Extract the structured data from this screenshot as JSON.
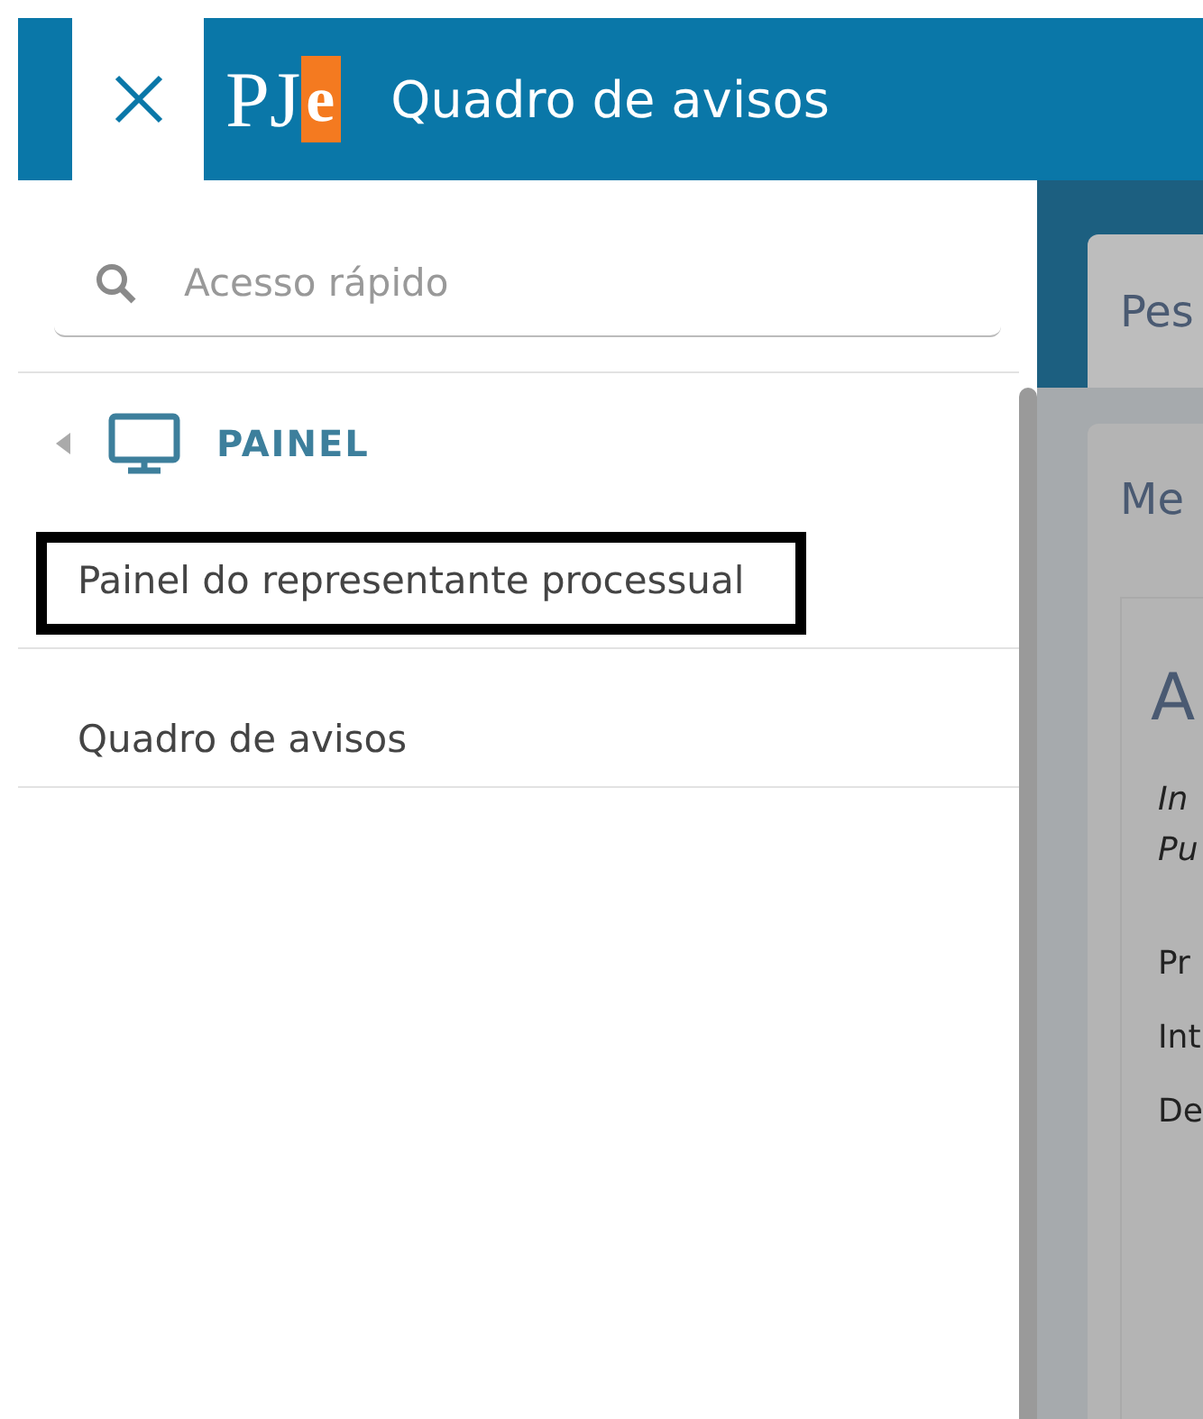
{
  "header": {
    "title": "Quadro de avisos",
    "logo": {
      "letters": "PJ",
      "accent": "e"
    }
  },
  "sidebar": {
    "search": {
      "placeholder": "Acesso rápido"
    },
    "section": {
      "label": "PAINEL",
      "expanded": true
    },
    "items": [
      {
        "label": "Painel do representante processual",
        "selected": true
      },
      {
        "label": "Quadro de avisos",
        "selected": false
      }
    ]
  },
  "main": {
    "top_card": {
      "text": "Pes"
    },
    "card": {
      "title": "Me",
      "heading": "A",
      "italic_lines": [
        "In",
        "Pu"
      ],
      "lines": [
        "Pr",
        "Int",
        "De"
      ]
    }
  }
}
